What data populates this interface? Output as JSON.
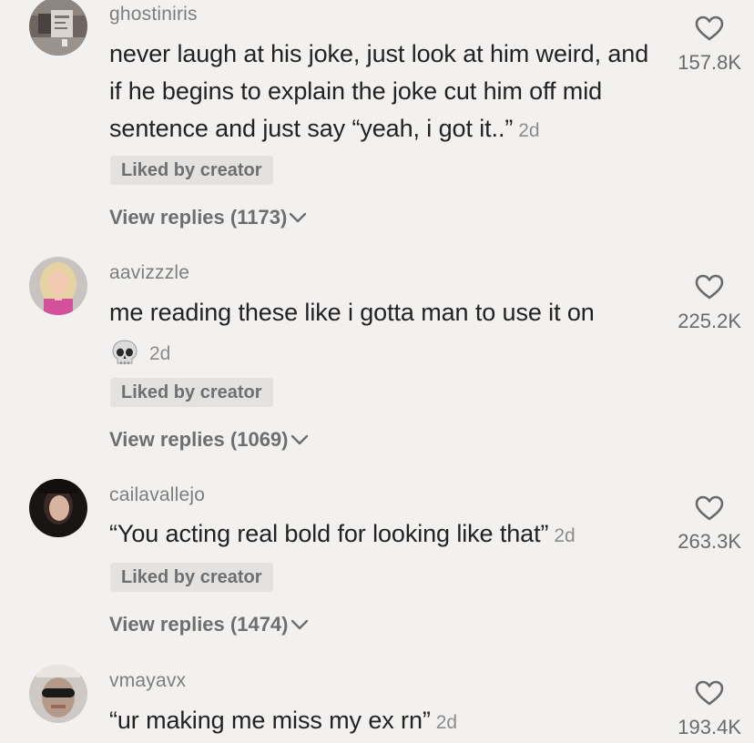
{
  "comments": [
    {
      "username": "ghostiniris",
      "text": "never laugh at his joke, just look at him weird, and if he begins to explain the joke cut him off mid sentence and just say “yeah, i got it..”",
      "age": "2d",
      "liked_badge": "Liked by creator",
      "replies": "View replies (1173)",
      "likes": "157.8K"
    },
    {
      "username": "aavizzzle",
      "text": "me reading these like i gotta man to use it on",
      "emoji": "skull-emoji",
      "age": "2d",
      "liked_badge": "Liked by creator",
      "replies": "View replies (1069)",
      "likes": "225.2K"
    },
    {
      "username": "cailavallejo",
      "text": "“You acting real bold for looking like that”",
      "age": "2d",
      "liked_badge": "Liked by creator",
      "replies": "View replies (1474)",
      "likes": "263.3K"
    },
    {
      "username": "vmayavx",
      "text": "“ur making me miss my ex rn”",
      "age": "2d",
      "likes": "193.4K"
    }
  ],
  "icons": {
    "like": "heart-outline-icon",
    "expand": "chevron-down-icon"
  },
  "colors": {
    "background": "#f2f1f0",
    "badge": "#e3e2e1",
    "muted_text": "#7d7d7d"
  }
}
